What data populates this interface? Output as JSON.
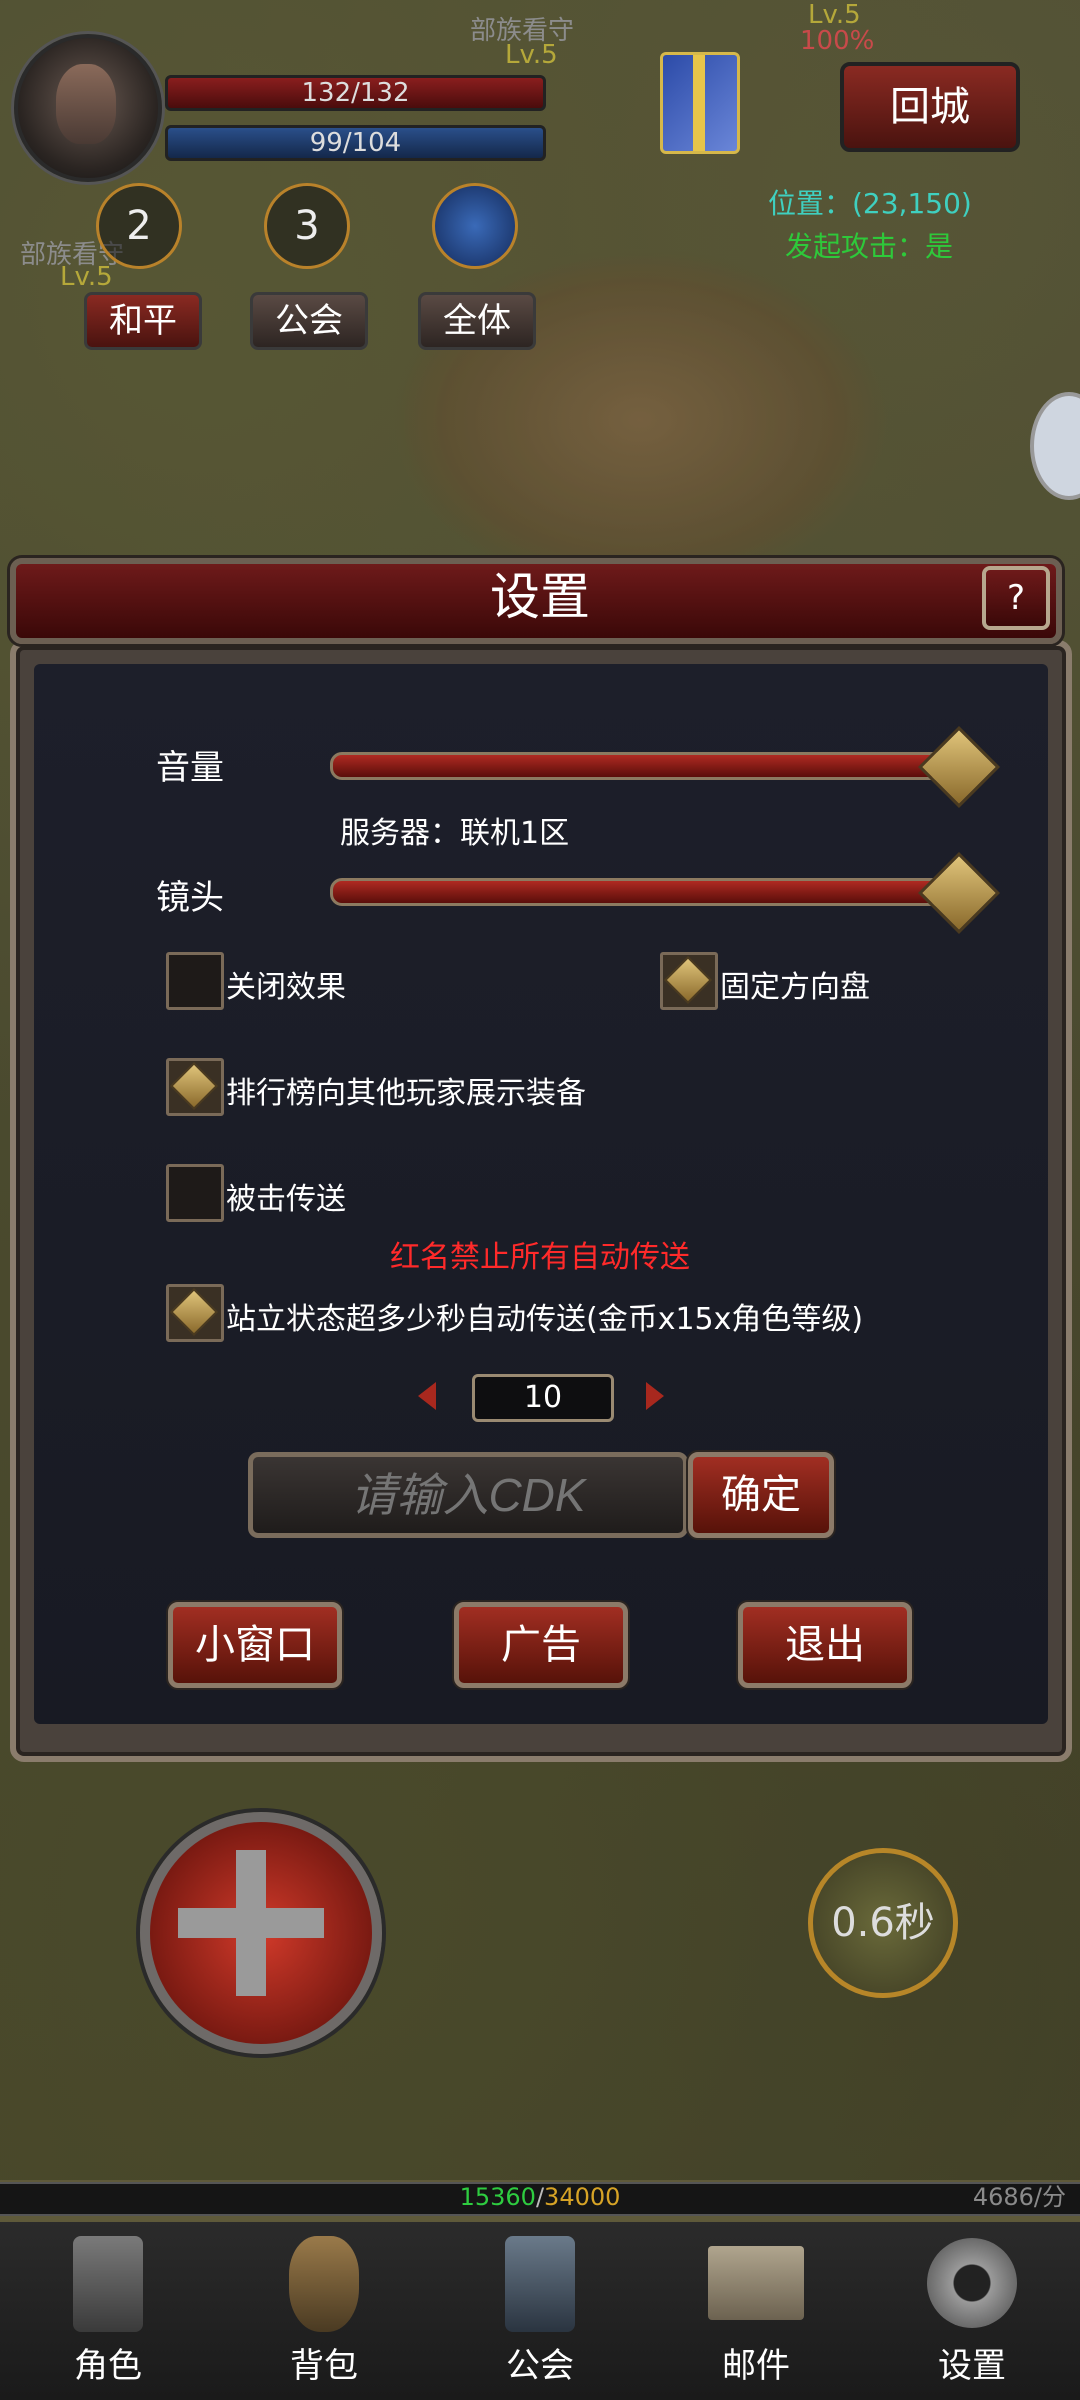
{
  "hud": {
    "hp": "132/132",
    "mp": "99/104",
    "circles": [
      "2",
      "3"
    ],
    "channels": [
      "和平",
      "公会",
      "全体"
    ],
    "return_city": "回城",
    "coordinate": "位置：(23,150)",
    "green_text": "发起攻击：是",
    "mob_labels": [
      "部族看守",
      "Lv.5",
      "部族看守",
      "Lv.5",
      "Lv.5",
      "100%"
    ]
  },
  "dialog": {
    "title": "设置",
    "help": "?",
    "volume_label": "音量",
    "volume_level": 1.0,
    "server_text": "服务器：联机1区",
    "camera_label": "镜头",
    "camera_level": 1.0,
    "options": [
      {
        "label": "关闭效果",
        "checked": false
      },
      {
        "label": "固定方向盘",
        "checked": true
      },
      {
        "label": "排行榜向其他玩家展示装备",
        "checked": true
      },
      {
        "label": "被击传送",
        "checked": false
      },
      {
        "label": "站立状态超多少秒自动传送(金币x15x角色等级)",
        "checked": true
      }
    ],
    "warning": "红名禁止所有自动传送",
    "stepper_value": "10",
    "cdk_placeholder": "请输入CDK",
    "confirm": "确定",
    "buttons": [
      "小窗口",
      "广告",
      "退出"
    ]
  },
  "skill": {
    "cooldown": "0.6秒"
  },
  "exp": {
    "current": "15360",
    "max": "34000",
    "rate": "4686/分"
  },
  "nav": [
    "角色",
    "背包",
    "公会",
    "邮件",
    "设置"
  ],
  "colors": {
    "accent_red": "#a12e22",
    "warning": "#ff2a2a",
    "gold": "#e0c47a",
    "panel": "#1d1f2a"
  }
}
